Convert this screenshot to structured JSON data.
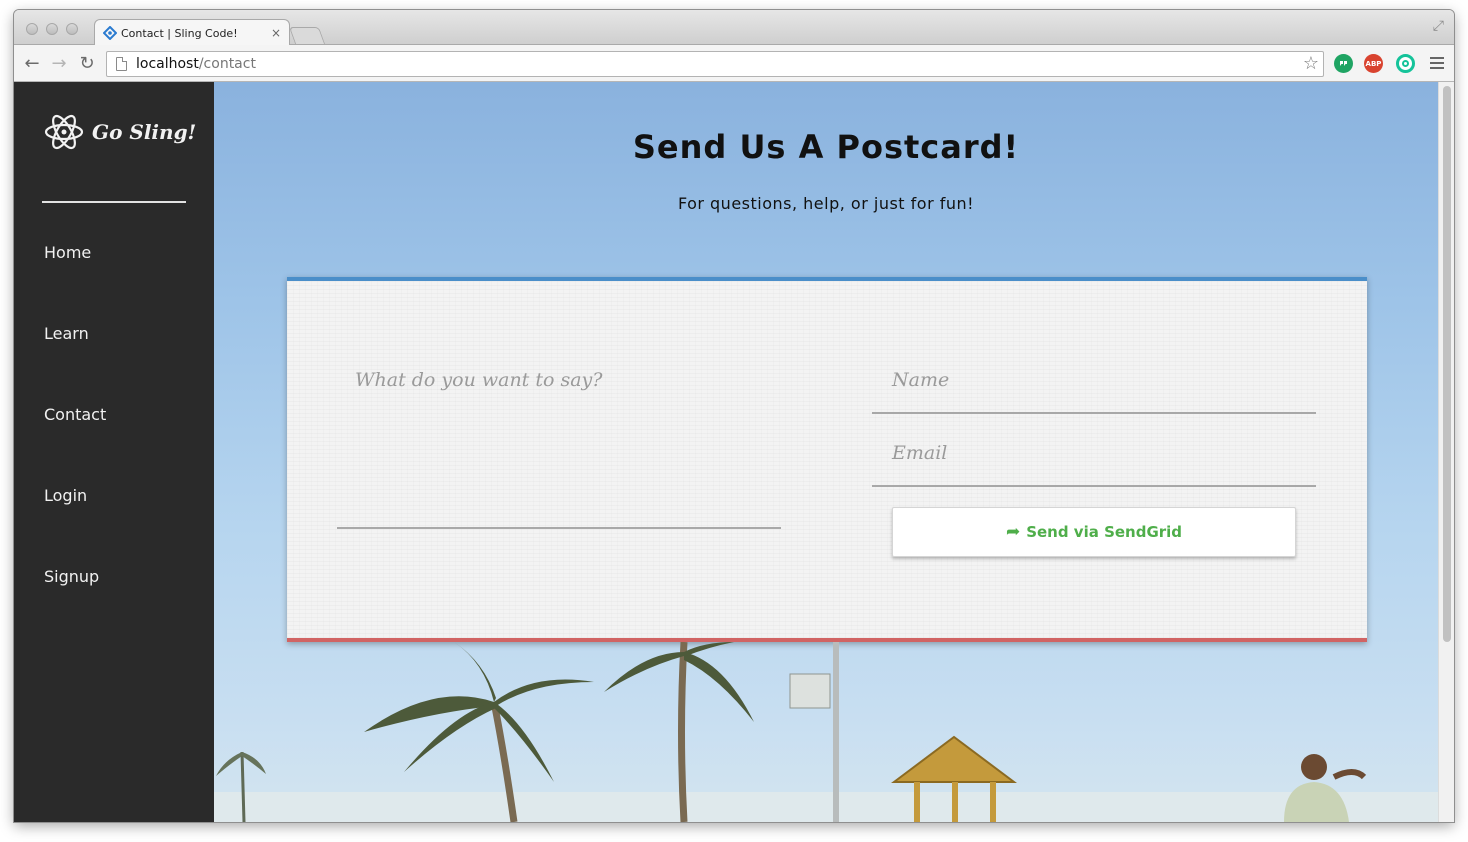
{
  "browser": {
    "tab_title": "Contact | Sling Code!",
    "tab_close": "×",
    "url_host": "localhost",
    "url_path": "/contact",
    "extensions": [
      {
        "name": "hangouts-icon",
        "label": "",
        "color": "#1fa463"
      },
      {
        "name": "adblock-icon",
        "label": "ABP",
        "color": "#d9432f"
      },
      {
        "name": "grammarly-icon",
        "label": "",
        "color": "#15c39a"
      }
    ]
  },
  "sidebar": {
    "brand": "Go Sling!",
    "items": [
      {
        "label": "Home"
      },
      {
        "label": "Learn"
      },
      {
        "label": "Contact"
      },
      {
        "label": "Login"
      },
      {
        "label": "Signup"
      }
    ]
  },
  "main": {
    "title": "Send Us A Postcard!",
    "subtitle": "For questions, help, or just for fun!",
    "form": {
      "message_placeholder": "What do you want to say?",
      "name_placeholder": "Name",
      "email_placeholder": "Email",
      "send_label": "Send via SendGrid"
    }
  },
  "colors": {
    "sidebar_bg": "#2a2a2a",
    "card_top_border": "#4a8ec9",
    "card_bottom_border": "#d16464",
    "send_text": "#4fae4a"
  }
}
